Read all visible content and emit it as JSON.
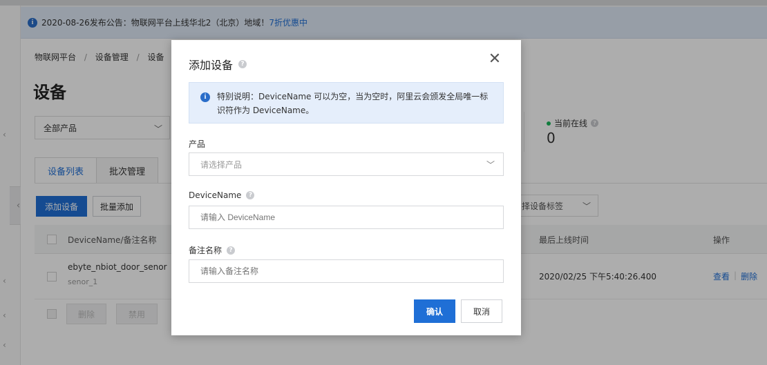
{
  "notice": {
    "text": "2020-08-26发布公告：物联网平台上线华北2（北京）地域！",
    "link": "7折优惠中"
  },
  "breadcrumb": {
    "items": [
      "物联网平台",
      "设备管理",
      "设备"
    ],
    "separator": "/"
  },
  "page": {
    "title": "设备"
  },
  "filter": {
    "product_selected": "全部产品"
  },
  "stats": {
    "online_label": "当前在线",
    "online_value": "0"
  },
  "tabs": [
    {
      "label": "设备列表",
      "active": true
    },
    {
      "label": "批次管理",
      "active": false
    }
  ],
  "toolbar": {
    "add_label": "添加设备",
    "batch_add_label": "批量添加",
    "tag_select_placeholder": "择设备标签"
  },
  "table": {
    "headers": {
      "name": "DeviceName/备注名称",
      "last_online": "最后上线时间",
      "actions": "操作"
    },
    "rows": [
      {
        "name": "ebyte_nbiot_door_senor",
        "note": "senor_1",
        "last_online": "2020/02/25 下午5:40:26.400",
        "view": "查看",
        "delete": "删除"
      }
    ],
    "footer": {
      "delete_label": "删除",
      "disable_label": "禁用"
    }
  },
  "dialog": {
    "title": "添加设备",
    "tip": "特别说明：DeviceName 可以为空，当为空时，阿里云会颁发全局唯一标识符作为 DeviceName。",
    "product_label": "产品",
    "product_placeholder": "请选择产品",
    "devicename_label": "DeviceName",
    "devicename_placeholder": "请输入 DeviceName",
    "note_label": "备注名称",
    "note_placeholder": "请输入备注名称",
    "confirm_label": "确认",
    "cancel_label": "取消"
  },
  "colors": {
    "primary": "#1f6fd6",
    "online_dot": "#1ab75b",
    "tip_background": "#e5eefb"
  }
}
